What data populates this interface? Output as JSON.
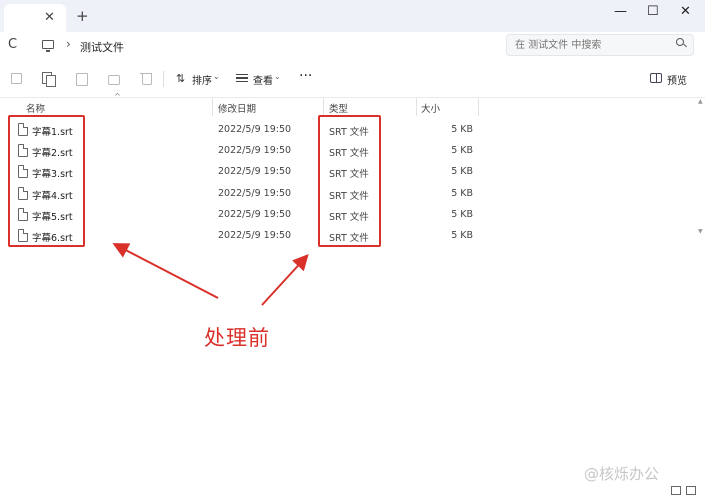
{
  "window": {
    "tab_close": "✕",
    "new_tab": "+",
    "minimize": "—",
    "maximize": "☐",
    "close": "✕"
  },
  "address": {
    "refresh": "C",
    "separator": "›",
    "breadcrumb": "测试文件",
    "search_placeholder": "在 测试文件 中搜索"
  },
  "toolbar": {
    "sort_label": "排序",
    "view_label": "查看",
    "more_label": "···",
    "preview_label": "预览",
    "chevron": "⌄"
  },
  "columns": {
    "name": "名称",
    "date": "修改日期",
    "type": "类型",
    "size": "大小",
    "sort_indicator": "^"
  },
  "files": [
    {
      "name": "字幕1.srt",
      "date": "2022/5/9 19:50",
      "type": "SRT 文件",
      "size": "5 KB"
    },
    {
      "name": "字幕2.srt",
      "date": "2022/5/9 19:50",
      "type": "SRT 文件",
      "size": "5 KB"
    },
    {
      "name": "字幕3.srt",
      "date": "2022/5/9 19:50",
      "type": "SRT 文件",
      "size": "5 KB"
    },
    {
      "name": "字幕4.srt",
      "date": "2022/5/9 19:50",
      "type": "SRT 文件",
      "size": "5 KB"
    },
    {
      "name": "字幕5.srt",
      "date": "2022/5/9 19:50",
      "type": "SRT 文件",
      "size": "5 KB"
    },
    {
      "name": "字幕6.srt",
      "date": "2022/5/9 19:50",
      "type": "SRT 文件",
      "size": "5 KB"
    }
  ],
  "annotation": {
    "caption": "处理前",
    "color": "#d9302a"
  },
  "watermark": "@核烁办公"
}
